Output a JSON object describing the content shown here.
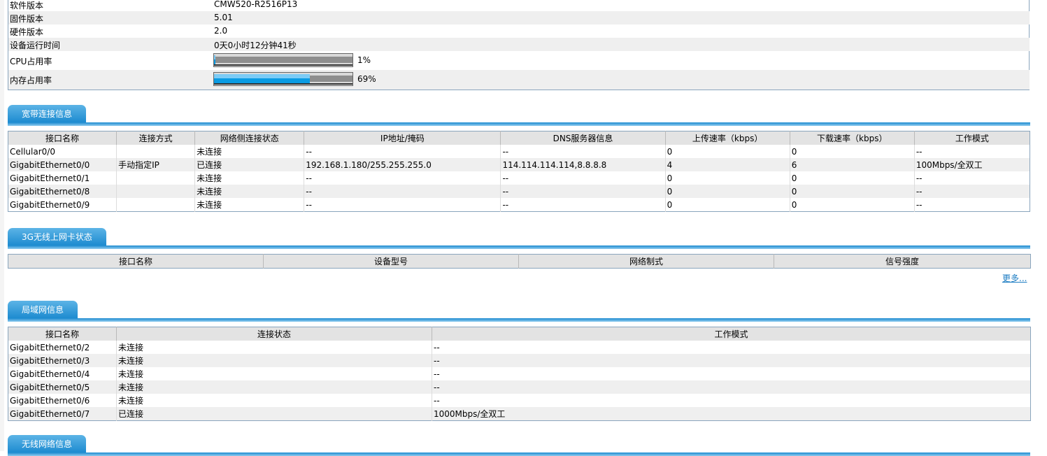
{
  "device_info": {
    "rows": [
      {
        "label": "软件版本",
        "value": "CMW520-R2516P13"
      },
      {
        "label": "固件版本",
        "value": "5.01"
      },
      {
        "label": "硬件版本",
        "value": "2.0"
      },
      {
        "label": "设备运行时间",
        "value": "0天0小时12分钟41秒"
      }
    ],
    "cpu": {
      "label": "CPU占用率",
      "percent_text": "1%",
      "percent": 1
    },
    "memory": {
      "label": "内存占用率",
      "percent_text": "69%",
      "percent": 69
    }
  },
  "broadband": {
    "title": "宽带连接信息",
    "headers": [
      "接口名称",
      "连接方式",
      "网络侧连接状态",
      "IP地址/掩码",
      "DNS服务器信息",
      "上传速率（kbps）",
      "下载速率（kbps）",
      "工作模式"
    ],
    "rows": [
      [
        "Cellular0/0",
        "",
        "未连接",
        "--",
        "--",
        "0",
        "0",
        "--"
      ],
      [
        "GigabitEthernet0/0",
        "手动指定IP",
        "已连接",
        "192.168.1.180/255.255.255.0",
        "114.114.114.114,8.8.8.8",
        "4",
        "6",
        "100Mbps/全双工"
      ],
      [
        "GigabitEthernet0/1",
        "",
        "未连接",
        "--",
        "--",
        "0",
        "0",
        "--"
      ],
      [
        "GigabitEthernet0/8",
        "",
        "未连接",
        "--",
        "--",
        "0",
        "0",
        "--"
      ],
      [
        "GigabitEthernet0/9",
        "",
        "未连接",
        "--",
        "--",
        "0",
        "0",
        "--"
      ]
    ]
  },
  "wireless3g": {
    "title": "3G无线上网卡状态",
    "headers": [
      "接口名称",
      "设备型号",
      "网络制式",
      "信号强度"
    ],
    "more_link": "更多..."
  },
  "lan": {
    "title": "局域网信息",
    "headers": [
      "接口名称",
      "连接状态",
      "工作模式"
    ],
    "rows": [
      [
        "GigabitEthernet0/2",
        "未连接",
        "--"
      ],
      [
        "GigabitEthernet0/3",
        "未连接",
        "--"
      ],
      [
        "GigabitEthernet0/4",
        "未连接",
        "--"
      ],
      [
        "GigabitEthernet0/5",
        "未连接",
        "--"
      ],
      [
        "GigabitEthernet0/6",
        "未连接",
        "--"
      ],
      [
        "GigabitEthernet0/7",
        "已连接",
        "1000Mbps/全双工"
      ]
    ]
  },
  "wlan": {
    "title": "无线网络信息"
  },
  "colors": {
    "tab_gradient_top": "#5cb4e6",
    "tab_gradient_bottom": "#1d8bd0",
    "link": "#1a7bc2",
    "bar_fill": "#0a9be3"
  }
}
